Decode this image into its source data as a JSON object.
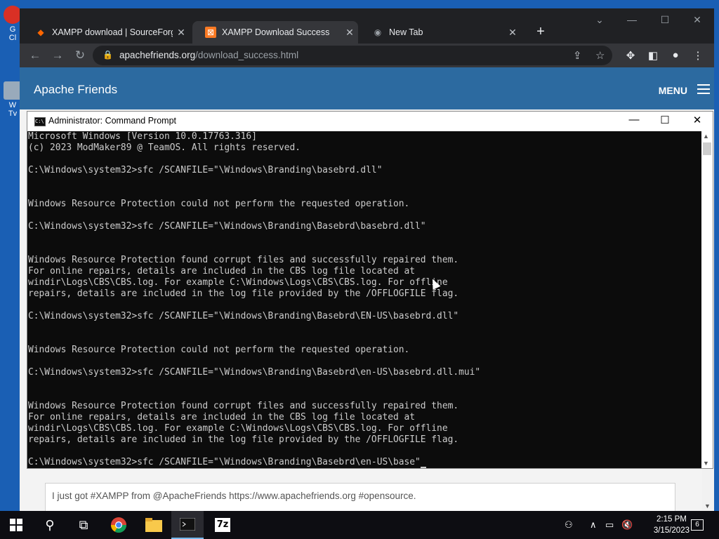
{
  "browser": {
    "tabs": [
      {
        "title": "XAMPP download | SourceForge",
        "icon": "sourceforge-icon"
      },
      {
        "title": "XAMPP Download Success",
        "icon": "xampp-icon",
        "active": true
      },
      {
        "title": "New Tab",
        "icon": "chrome-icon"
      }
    ],
    "url_host": "apachefriends.org",
    "url_path": "/download_success.html"
  },
  "site": {
    "brand": "Apache Friends",
    "menu_label": "MENU",
    "tweet_text": "I just got #XAMPP from @ApacheFriends https://www.apachefriends.org #opensource."
  },
  "cmd": {
    "title": "Administrator: Command Prompt",
    "lines": [
      "Microsoft Windows [Version 10.0.17763.316]",
      "(c) 2023 ModMaker89 @ TeamOS. All rights reserved.",
      "",
      "C:\\Windows\\system32>sfc /SCANFILE=\"\\Windows\\Branding\\basebrd.dll\"",
      "",
      "",
      "Windows Resource Protection could not perform the requested operation.",
      "",
      "C:\\Windows\\system32>sfc /SCANFILE=\"\\Windows\\Branding\\Basebrd\\basebrd.dll\"",
      "",
      "",
      "Windows Resource Protection found corrupt files and successfully repaired them.",
      "For online repairs, details are included in the CBS log file located at",
      "windir\\Logs\\CBS\\CBS.log. For example C:\\Windows\\Logs\\CBS\\CBS.log. For offline",
      "repairs, details are included in the log file provided by the /OFFLOGFILE flag.",
      "",
      "C:\\Windows\\system32>sfc /SCANFILE=\"\\Windows\\Branding\\Basebrd\\EN-US\\basebrd.dll\"",
      "",
      "",
      "Windows Resource Protection could not perform the requested operation.",
      "",
      "C:\\Windows\\system32>sfc /SCANFILE=\"\\Windows\\Branding\\Basebrd\\en-US\\basebrd.dll.mui\"",
      "",
      "",
      "Windows Resource Protection found corrupt files and successfully repaired them.",
      "For online repairs, details are included in the CBS log file located at",
      "windir\\Logs\\CBS\\CBS.log. For example C:\\Windows\\Logs\\CBS\\CBS.log. For offline",
      "repairs, details are included in the log file provided by the /OFFLOGFILE flag.",
      "",
      "C:\\Windows\\system32>sfc /SCANFILE=\"\\Windows\\Branding\\Basebrd\\en-US\\base\""
    ]
  },
  "desktop": {
    "icons": [
      {
        "label": "G\nCl"
      },
      {
        "label": "W\nTv"
      }
    ]
  },
  "taskbar": {
    "time": "2:15 PM",
    "date": "3/15/2023",
    "notification_count": "6",
    "apps": [
      "start-icon",
      "search-icon",
      "task-view-icon",
      "chrome-icon",
      "file-explorer-icon",
      "cmd-icon",
      "7zip-icon"
    ],
    "sevenzip_label": "7z"
  }
}
